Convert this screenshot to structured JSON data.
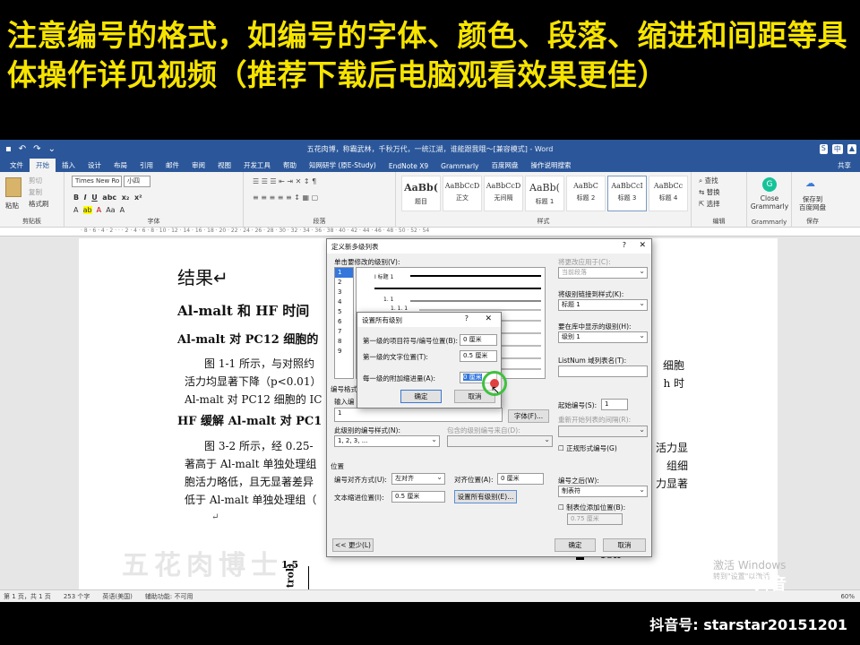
{
  "banner": {
    "text": "注意编号的格式，如编号的字体、颜色、段落、缩进和间距等具体操作详见视频（推荐下载后电脑观看效果更佳）"
  },
  "word": {
    "title": "五花肉博，称霸武林，千秋万代，一统江湖，谁能跟我哦～[兼容模式] - Word",
    "tabs": [
      "文件",
      "开始",
      "插入",
      "设计",
      "布局",
      "引用",
      "邮件",
      "审阅",
      "视图",
      "开发工具",
      "帮助",
      "知网研学 (原E-Study)",
      "EndNote X9",
      "Grammarly",
      "百度网盘",
      "操作说明搜索"
    ],
    "share": "共享",
    "ribbon": {
      "clipboard": {
        "paste": "粘贴",
        "cut": "剪切",
        "copy": "复制",
        "painter": "格式刷",
        "label": "剪贴板"
      },
      "font": {
        "name": "Times New Ro",
        "size": "小四",
        "label": "字体"
      },
      "paragraph_label": "段落",
      "styles": [
        {
          "preview": "AaBb(",
          "name": "题目"
        },
        {
          "preview": "AaBbCcD",
          "name": "正文"
        },
        {
          "preview": "AaBbCcD",
          "name": "无间隔"
        },
        {
          "preview": "AaBb(",
          "name": "标题 1"
        },
        {
          "preview": "AaBbC",
          "name": "标题 2"
        },
        {
          "preview": "AaBbCcI",
          "name": "标题 3"
        },
        {
          "preview": "AaBbCc",
          "name": "标题 4"
        }
      ],
      "styles_label": "样式",
      "editing": {
        "find": "查找",
        "replace": "替换",
        "select": "选择",
        "label": "编辑"
      },
      "grammarly": {
        "line1": "Close",
        "line2": "Grammarly",
        "label": "Grammarly"
      },
      "baidu": {
        "line1": "保存到",
        "line2": "百度网盘",
        "label": "保存"
      }
    },
    "document": {
      "h1": "结果↵",
      "h2": "Al-malt 和 HF 时间",
      "h3a": "Al-malt 对 PC12 细胞的",
      "p1": [
        "图 1-1 所示，与对照约",
        "活力均显著下降（p<0.01）",
        "Al-malt 对 PC12 细胞的 IC"
      ],
      "p1_right": [
        "细胞",
        "h 时"
      ],
      "h3b": "HF 缓解 Al-malt 对 PC1",
      "p2": [
        "图 3-2 所示，经 0.25-",
        "著高于 Al-malt 单独处理组",
        "胞活力略低，且无显著差异",
        "低于 Al-malt 单独处理组（"
      ],
      "p2_right": [
        "活力显",
        "组细",
        "力显著"
      ],
      "chart_y": "1.5",
      "chart_axis": "trol)",
      "legend_48h": "48h",
      "watermark": "五花肉博士"
    },
    "status": [
      "第 1 页，共 1 页",
      "253 个字",
      "英语(美国)",
      "辅助功能: 不可用"
    ],
    "activate": {
      "line1": "激活 Windows",
      "line2": "转到\"设置\"以激活"
    },
    "zoom": "60%"
  },
  "dialog_main": {
    "title": "定义新多级列表",
    "level_label": "单击要修改的级别(V):",
    "levels": [
      "1",
      "2",
      "3",
      "4",
      "5",
      "6",
      "7",
      "8",
      "9"
    ],
    "preview_items": [
      "I 标题 1",
      "1. 1",
      "1. 1. 1"
    ],
    "apply_to_label": "将更改应用于(C):",
    "apply_to_value": "当前段落",
    "link_style_label": "将级别链接到样式(K):",
    "link_style_value": "标题 1",
    "gallery_level_label": "要在库中显示的级别(H):",
    "gallery_level_value": "级别 1",
    "listnum_label": "ListNum 域列表名(T):",
    "format_section": "编号格式",
    "input_format_label": "输入编",
    "font_button": "字体(F)...",
    "number_style_label": "此级别的编号样式(N):",
    "number_style_value": "1, 2, 3, ...",
    "include_level_label": "包含的级别编号来自(D):",
    "start_at_label": "起始编号(S):",
    "start_at_value": "1",
    "restart_label": "重新开始列表的间隔(R):",
    "legal_label": "正规形式编号(G)",
    "position_section": "位置",
    "align_label": "编号对齐方式(U):",
    "align_value": "左对齐",
    "aligned_at_label": "对齐位置(A):",
    "aligned_at_value": "0 厘米",
    "indent_label": "文本缩进位置(I):",
    "indent_value": "0.5 厘米",
    "set_all_button": "设置所有级别(E)...",
    "follow_label": "编号之后(W):",
    "follow_value": "制表符",
    "tab_add_label": "制表位添加位置(B):",
    "tab_add_value": "0.75 厘米",
    "less_button": "<< 更少(L)",
    "ok": "确定",
    "cancel": "取消"
  },
  "dialog_small": {
    "title": "设置所有级别",
    "first_pos_label": "第一级的项目符号/编号位置(B):",
    "first_pos_value": "0 厘米",
    "first_text_label": "第一级的文字位置(T):",
    "first_text_value": "0.5 厘米",
    "extra_indent_label": "每一级的附加缩进量(A):",
    "extra_indent_value": "0 厘米",
    "ok": "确定",
    "cancel": "取消"
  },
  "footer": {
    "douyin_logo": "抖音",
    "account": "抖音号: starstar20151201"
  }
}
